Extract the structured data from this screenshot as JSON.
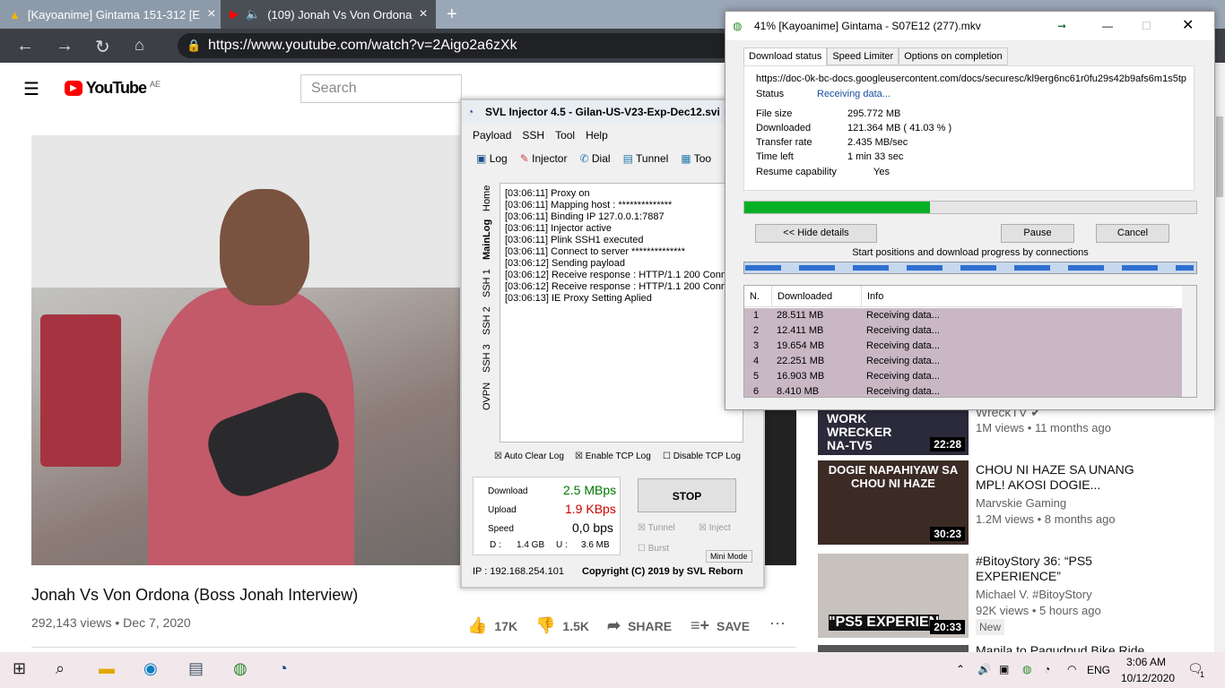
{
  "browser": {
    "tabs": [
      {
        "title": "[Kayoanime] Gintama 151-312 [E",
        "icon": "drive-icon"
      },
      {
        "title": "(109) Jonah Vs Von Ordona",
        "icon": "youtube-icon",
        "audio": "speaker-icon"
      }
    ],
    "new_tab": "+",
    "url": "https://www.youtube.com/watch?v=2Aigo2a6zXk"
  },
  "youtube": {
    "logo": "YouTube",
    "region": "AE",
    "search_placeholder": "Search",
    "video": {
      "title": "Jonah Vs Von Ordona (Boss Jonah Interview)",
      "views": "292,143 views • Dec 7, 2020",
      "likes": "17K",
      "dislikes": "1.5K",
      "share": "SHARE",
      "save": "SAVE"
    },
    "recommendations": [
      {
        "thumb_text": "WORK WRECKER NA-TV5",
        "channel": "WreckTV",
        "meta": "1M views • 11 months ago",
        "duration": "22:28",
        "title": ""
      },
      {
        "thumb_text": "DOGIE NAPAHIYAW SA CHOU NI HAZE",
        "title": "CHOU NI HAZE SA UNANG MPL! AKOSI DOGIE...",
        "channel": "Marvskie Gaming",
        "meta": "1.2M views • 8 months ago",
        "duration": "30:23"
      },
      {
        "thumb_text": "\"PS5 EXPERIEN",
        "title": "#BitoyStory 36: “PS5 EXPERIENCE”",
        "channel": "Michael V. #BitoyStory",
        "meta": "92K views • 5 hours ago",
        "badge": "New",
        "duration": "20:33"
      },
      {
        "title": "Manila to Pagudpud Bike Ride"
      }
    ]
  },
  "svl": {
    "title": "SVL Injector 4.5 - Gilan-US-V23-Exp-Dec12.svi",
    "menu": [
      "Payload",
      "SSH",
      "Tool",
      "Help"
    ],
    "tabs": [
      "Log",
      "Injector",
      "Dial",
      "Tunnel",
      "Too"
    ],
    "vtabs": [
      "Home",
      "MainLog",
      "SSH 1",
      "SSH 2",
      "SSH 3",
      "OVPN"
    ],
    "log": [
      "[03:06:11] Proxy on",
      "[03:06:11] Mapping host : **************",
      "[03:06:11] Binding IP 127.0.0.1:7887",
      "[03:06:11] Injector active",
      "[03:06:11] Plink SSH1 executed",
      "[03:06:11] Connect to server **************",
      "[03:06:12] Sending payload",
      "[03:06:12] Receive response : HTTP/1.1 200 Conn",
      "[03:06:12] Receive response : HTTP/1.1 200 Conn",
      "[03:06:13] IE Proxy Setting Aplied"
    ],
    "checks": [
      "Auto Clear Log",
      "Enable TCP Log",
      "Disable TCP Log"
    ],
    "download_label": "Download",
    "download": "2.5 MBps",
    "upload_label": "Upload",
    "upload": "1.9 KBps",
    "speed_label": "Speed",
    "speed": "0,0 bps",
    "d_label": "D :",
    "d_val": "1.4 GB",
    "u_label": "U :",
    "u_val": "3.6 MB",
    "stop": "STOP",
    "tunnel": "Tunnel",
    "inject": "Inject",
    "burst": "Burst",
    "mini": "Mini Mode",
    "ip": "IP : 192.168.254.101",
    "copyright": "Copyright (C) 2019 by SVL Reborn"
  },
  "idm": {
    "title": "41% [Kayoanime] Gintama - S07E12 (277).mkv",
    "tabs": [
      "Download status",
      "Speed Limiter",
      "Options on completion"
    ],
    "url": "https://doc-0k-bc-docs.googleusercontent.com/docs/securesc/kl9erg6nc61r0fu29s42b9afs6m1s5tp",
    "status_label": "Status",
    "status": "Receiving data...",
    "size_label": "File size",
    "size": "295.772  MB",
    "downloaded_label": "Downloaded",
    "downloaded": "121.364  MB  ( 41.03 % )",
    "rate_label": "Transfer rate",
    "rate": "2.435  MB/sec",
    "left_label": "Time left",
    "left": "1 min 33 sec",
    "resume_label": "Resume capability",
    "resume": "Yes",
    "progress": 0.4103,
    "hide": "<< Hide details",
    "pause": "Pause",
    "cancel": "Cancel",
    "conn_caption": "Start positions and download progress by connections",
    "columns": [
      "N.",
      "Downloaded",
      "Info"
    ],
    "rows": [
      [
        "1",
        "28.511  MB",
        "Receiving data..."
      ],
      [
        "2",
        "12.411  MB",
        "Receiving data..."
      ],
      [
        "3",
        "19.654  MB",
        "Receiving data..."
      ],
      [
        "4",
        "22.251  MB",
        "Receiving data..."
      ],
      [
        "5",
        "16.903  MB",
        "Receiving data..."
      ],
      [
        "6",
        "8.410  MB",
        "Receiving data..."
      ]
    ]
  },
  "taskbar": {
    "lang": "ENG",
    "time": "3:06 AM",
    "date": "10/12/2020",
    "notif": "1"
  }
}
